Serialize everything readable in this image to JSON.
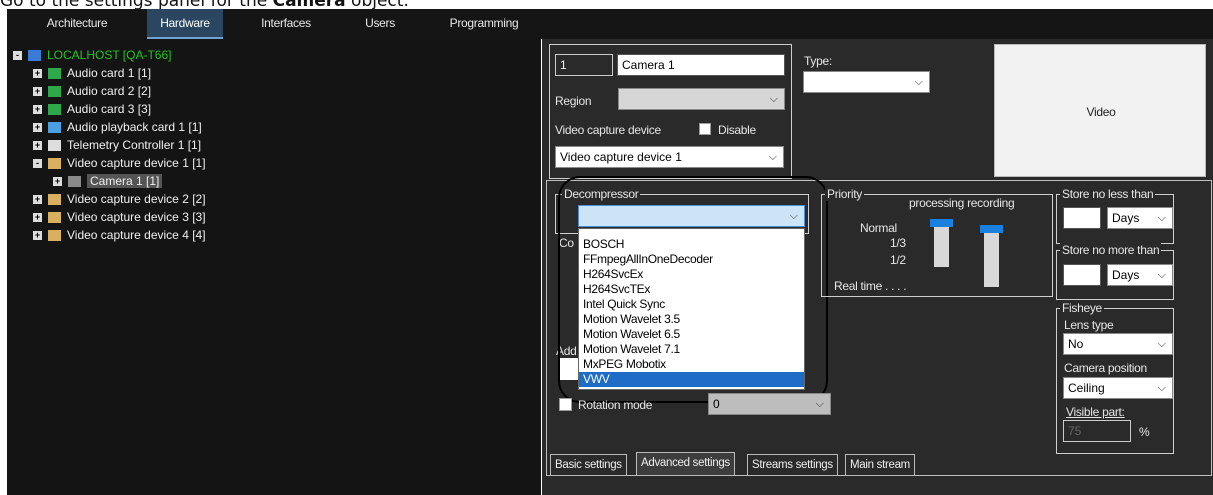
{
  "caption": {
    "prefix": "Go to the settings panel for the ",
    "bold": "Camera",
    "suffix": " object."
  },
  "tabs": [
    "Architecture",
    "Hardware",
    "Interfaces",
    "Users",
    "Programming"
  ],
  "tree": [
    {
      "label": "LOCALHOST [QA-T66]",
      "level": 0,
      "expander": "-",
      "color": "#21c321"
    },
    {
      "label": "Audio card 1 [1]",
      "level": 1,
      "expander": "+"
    },
    {
      "label": "Audio card 2 [2]",
      "level": 1,
      "expander": "+"
    },
    {
      "label": "Audio card 3 [3]",
      "level": 1,
      "expander": "+"
    },
    {
      "label": "Audio playback card 1 [1]",
      "level": 1,
      "expander": "+"
    },
    {
      "label": "Telemetry Controller 1 [1]",
      "level": 1,
      "expander": "+"
    },
    {
      "label": "Video capture device 1 [1]",
      "level": 1,
      "expander": "-"
    },
    {
      "label": "Camera 1 [1]",
      "level": 2,
      "expander": "+",
      "selected": true
    },
    {
      "label": "Video capture device 2 [2]",
      "level": 1,
      "expander": "+"
    },
    {
      "label": "Video capture device 3 [3]",
      "level": 1,
      "expander": "+"
    },
    {
      "label": "Video capture device 4 [4]",
      "level": 1,
      "expander": "+"
    }
  ],
  "settings": {
    "id_value": "1",
    "name_value": "Camera 1",
    "type_label": "Type:",
    "region_label": "Region",
    "video_capture_label": "Video capture device",
    "disable_label": "Disable",
    "video_capture_value": "Video capture device 1",
    "video_preview_label": "Video",
    "decompressor_label": "Decompressor",
    "decompressor_options": [
      "BOSCH",
      "FFmpegAllInOneDecoder",
      "H264SvcEx",
      "H264SvcTEx",
      "Intel Quick Sync",
      "Motion Wavelet 3.5",
      "Motion Wavelet 6.5",
      "Motion Wavelet 7.1",
      "MxPEG Mobotix",
      "VWV"
    ],
    "decompressor_selected": "VWV",
    "co_partial": "Co",
    "add_partial": "Add",
    "priority_label": "Priority",
    "processing_recording_label": "processing recording",
    "normal_label": "Normal",
    "one_third_label": "1/3",
    "half_label": "1/2",
    "realtime_label": "Real time . . . .",
    "store_no_less_label": "Store no less than",
    "store_no_more_label": "Store no more than",
    "days_label": "Days",
    "fisheye_label": "Fisheye",
    "lens_type_label": "Lens type",
    "lens_type_value": "No",
    "camera_position_label": "Camera position",
    "camera_position_value": "Ceiling",
    "visible_part_label": "Visible part:",
    "visible_part_value": "75",
    "percent_label": "%",
    "rotation_label": "Rotation mode",
    "rotation_value": "0"
  },
  "bottom_tabs": [
    "Basic settings",
    "Advanced settings",
    "Streams settings",
    "Main stream"
  ],
  "active_bottom_tab": "Advanced settings"
}
